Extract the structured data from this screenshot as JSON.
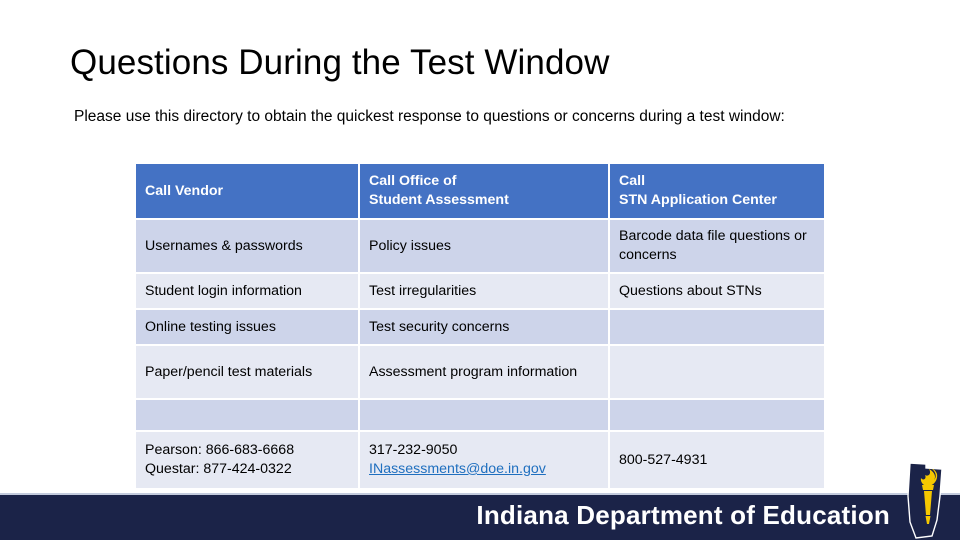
{
  "slide": {
    "title": "Questions During the Test Window",
    "intro": "Please use this directory to obtain the quickest response to questions or concerns during a test window:"
  },
  "table": {
    "headers": [
      "Call Vendor",
      "Call Office of\nStudent Assessment",
      "Call\nSTN Application Center"
    ],
    "header_lines": {
      "col1_line1": "Call Vendor",
      "col2_line1": "Call Office of",
      "col2_line2": "Student Assessment",
      "col3_line1": "Call",
      "col3_line2": "STN Application Center"
    },
    "rows": [
      {
        "style": "dark",
        "cells": [
          "Usernames & passwords",
          "Policy issues",
          "Barcode data file questions or concerns"
        ]
      },
      {
        "style": "light",
        "cells": [
          "Student login information",
          "Test irregularities",
          "Questions about STNs"
        ]
      },
      {
        "style": "dark",
        "cells": [
          "Online testing issues",
          "Test security concerns",
          ""
        ]
      },
      {
        "style": "light",
        "cells": [
          "Paper/pencil test materials",
          "Assessment program information",
          ""
        ]
      },
      {
        "style": "dark",
        "cells": [
          "",
          "",
          ""
        ]
      }
    ],
    "contact_row": {
      "style": "light",
      "vendor_line1": "Pearson: 866-683-6668",
      "vendor_line2": "Questar: 877-424-0322",
      "office_phone": "317-232-9050",
      "office_email": "INassessments@doe.in.gov",
      "stn_phone": "800-527-4931"
    }
  },
  "footer": {
    "title": "Indiana Department of Education",
    "logo_name": "indiana-torch-logo"
  },
  "colors": {
    "header_blue": "#4472C4",
    "row_dark": "#CDD4EA",
    "row_light": "#E6E9F3",
    "footer_navy": "#1B2348",
    "torch_gold": "#F5C800",
    "link_blue": "#1F6FBF"
  }
}
